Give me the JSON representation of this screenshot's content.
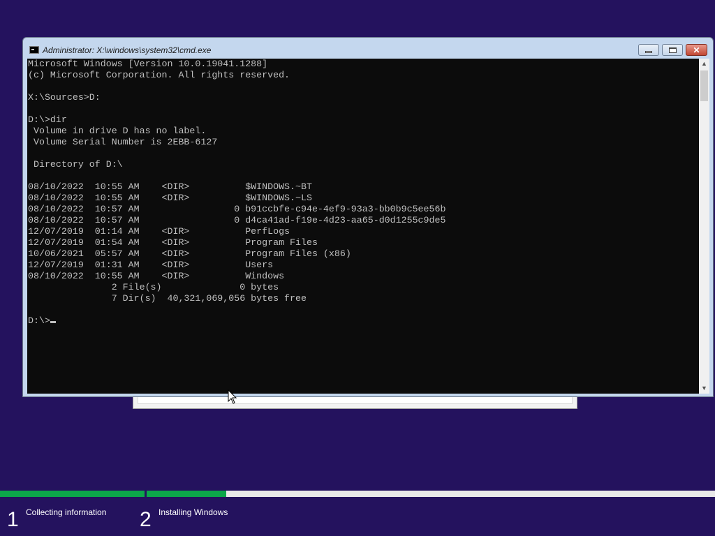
{
  "window": {
    "title": "Administrator: X:\\windows\\system32\\cmd.exe",
    "icon": "cmd-icon"
  },
  "console": {
    "lines": [
      "Microsoft Windows [Version 10.0.19041.1288]",
      "(c) Microsoft Corporation. All rights reserved.",
      "",
      "X:\\Sources>D:",
      "",
      "D:\\>dir",
      " Volume in drive D has no label.",
      " Volume Serial Number is 2EBB-6127",
      "",
      " Directory of D:\\",
      "",
      "08/10/2022  10:55 AM    <DIR>          $WINDOWS.~BT",
      "08/10/2022  10:55 AM    <DIR>          $WINDOWS.~LS",
      "08/10/2022  10:57 AM                 0 b91ccbfe-c94e-4ef9-93a3-bb0b9c5ee56b",
      "08/10/2022  10:57 AM                 0 d4ca41ad-f19e-4d23-aa65-d0d1255c9de5",
      "12/07/2019  01:14 AM    <DIR>          PerfLogs",
      "12/07/2019  01:54 AM    <DIR>          Program Files",
      "10/06/2021  05:57 AM    <DIR>          Program Files (x86)",
      "12/07/2019  01:31 AM    <DIR>          Users",
      "08/10/2022  10:55 AM    <DIR>          Windows",
      "               2 File(s)              0 bytes",
      "               7 Dir(s)  40,321,069,056 bytes free",
      ""
    ],
    "prompt": "D:\\>"
  },
  "steps": [
    {
      "number": "1",
      "label": "Collecting information",
      "progress": 1.0
    },
    {
      "number": "2",
      "label": "Installing Windows",
      "progress": 0.14
    }
  ],
  "colors": {
    "background": "#24125e",
    "progress": "#0ca64a"
  }
}
